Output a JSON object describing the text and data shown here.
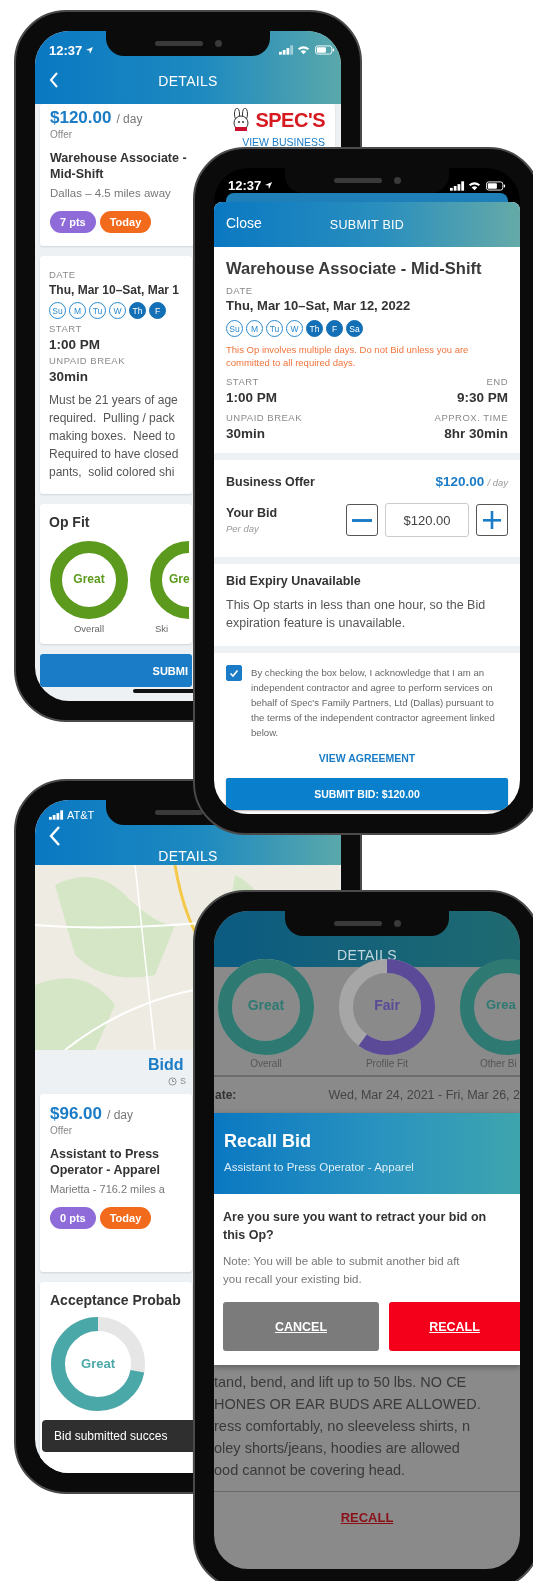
{
  "details_screen": {
    "status_time": "12:37",
    "title": "DETAILS",
    "offer": {
      "price": "$120.00",
      "unit": "/ day",
      "label": "Offer",
      "job": "Warehouse Associate - Mid-Shift",
      "location": "Dallas – 4.5 miles away",
      "business_logo": "SPEC'S",
      "business_link": "VIEW BUSINESS",
      "badges": [
        {
          "text": "7 pts",
          "color": "#8e6bd8"
        },
        {
          "text": "Today",
          "color": "#f26a1b"
        }
      ]
    },
    "schedule": {
      "date_label": "DATE",
      "date": "Thu, Mar 10–Sat, Mar 1",
      "start_label": "START",
      "start": "1:00 PM",
      "break_label": "UNPAID BREAK",
      "break": "30min",
      "days": [
        {
          "label": "Su",
          "selected": false
        },
        {
          "label": "M",
          "selected": false
        },
        {
          "label": "Tu",
          "selected": false
        },
        {
          "label": "W",
          "selected": false
        },
        {
          "label": "Th",
          "selected": true
        },
        {
          "label": "F",
          "selected": true
        }
      ],
      "description": [
        "Must be 21 years of age",
        "required.  Pulling / pack",
        "making boxes.  Need to",
        "Required to have closed",
        "pants,  solid colored shi"
      ]
    },
    "op_fit": {
      "title": "Op Fit",
      "rings": [
        {
          "kind": "whole",
          "rating": "Great",
          "label": "Overall",
          "level": 1
        },
        {
          "kind": "clipped",
          "rating": "Gre",
          "label": "Ski"
        }
      ]
    },
    "submit_button": "SUBMI"
  },
  "submit_bid_screen": {
    "status_time": "12:37",
    "close": "Close",
    "title": "SUBMIT BID",
    "job": "Warehouse Associate - Mid-Shift",
    "date_label": "DATE",
    "date": "Thu, Mar 10–Sat, Mar 12, 2022",
    "days": [
      {
        "label": "Su",
        "selected": false
      },
      {
        "label": "M",
        "selected": false
      },
      {
        "label": "Tu",
        "selected": false
      },
      {
        "label": "W",
        "selected": false
      },
      {
        "label": "Th",
        "selected": true
      },
      {
        "label": "F",
        "selected": true
      },
      {
        "label": "Sa",
        "selected": true
      }
    ],
    "warning": "This Op involves multiple days. Do not Bid unless you are committed to all required days.",
    "start_label": "START",
    "start": "1:00 PM",
    "end_label": "END",
    "end": "9:30 PM",
    "break_label": "UNPAID BREAK",
    "break": "30min",
    "approx_label": "APPROX. TIME",
    "approx": "8hr 30min",
    "offer_label": "Business Offer",
    "offer_price": "$120.00",
    "offer_unit": "/ day",
    "bid_label": "Your Bid",
    "bid_unit": "Per day",
    "bid_value": "$120.00",
    "expiry_title": "Bid Expiry Unavailable",
    "expiry_text": "This Op starts in less than one hour, so the Bid expiration feature is unavailable.",
    "agreement": {
      "checked": true,
      "text": "By checking the box below, I acknowledge that I am an independent contractor and agree to perform services on behalf of Spec's Family Partners, Ltd (Dallas) pursuant to the terms of the independent contractor agreement linked below."
    },
    "agreement_link": "VIEW AGREEMENT",
    "submit": "SUBMIT BID: $120.00"
  },
  "bid_detail_screen": {
    "carrier": "AT&T",
    "title": "DETAILS",
    "heading": "Bidd",
    "heading_note": "S",
    "offer": {
      "price": "$96.00",
      "unit": "/ day",
      "label": "Offer",
      "job": "Assistant to Press Operator - Apparel",
      "location": "Marietta - 716.2 miles a",
      "badges": [
        {
          "text": "0 pts",
          "color": "#8e6bd8"
        },
        {
          "text": "Today",
          "color": "#f26a1b"
        }
      ]
    },
    "acceptance": {
      "title": "Acceptance Probab",
      "rings": [
        {
          "rating": "Great",
          "level": 0.72
        }
      ]
    },
    "toast": "Bid submitted succes"
  },
  "recall_screen": {
    "title": "DETAILS",
    "rings": [
      {
        "kind": "whole",
        "rating": "Great",
        "label": "Overall",
        "level": 1,
        "color": "#2e7a72"
      },
      {
        "kind": "whole",
        "rating": "Fair",
        "label": "Profile Fit",
        "level": 0.6,
        "color": "#5a4a98"
      },
      {
        "kind": "clipped",
        "rating": "Grea",
        "label": "Other Bi",
        "color": "#2e7a72"
      }
    ],
    "date_label": "ate:",
    "date": "Wed, Mar 24, 2021 - Fri, Mar 26, 2",
    "dialog": {
      "title": "Recall Bid",
      "subtitle": "Assistant to Press Operator - Apparel",
      "question": "Are you sure you want to retract your bid on this Op?",
      "note": [
        "Note: You will be able to submit another bid aft",
        "you recall your existing bid."
      ],
      "buttons": [
        {
          "kind": "cancel",
          "label": "CANCEL"
        },
        {
          "kind": "confirm",
          "label": "RECALL"
        }
      ]
    },
    "description": [
      "tand, bend, and lift up to 50 lbs. NO CE",
      "HONES OR EAR BUDS ARE ALLOWED.",
      "ress comfortably, no sleeveless shirts, n",
      "oley shorts/jeans, hoodies are allowed",
      "ood cannot be covering head."
    ],
    "recall_link": "RECALL"
  }
}
